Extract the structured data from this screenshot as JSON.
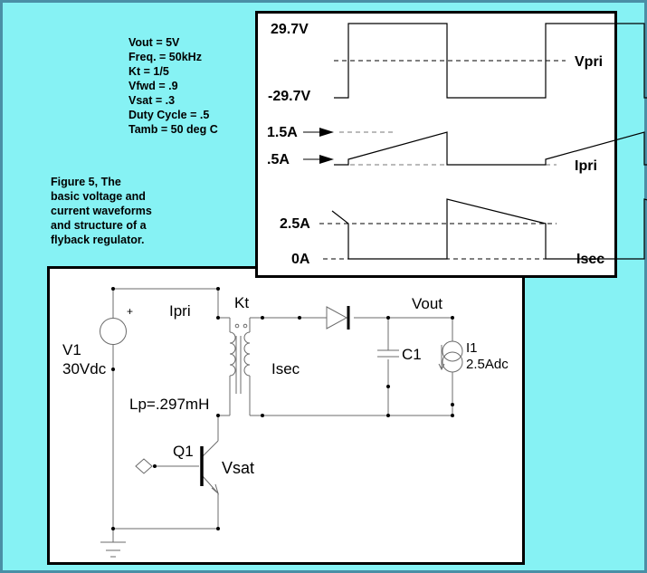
{
  "parameters": [
    {
      "label": "Vout = 5V"
    },
    {
      "label": "Freq. = 50kHz"
    },
    {
      "label": "Kt = 1/5"
    },
    {
      "label": "Vfwd = .9"
    },
    {
      "label": "Vsat = .3"
    },
    {
      "label": "Duty Cycle = .5"
    },
    {
      "label": "Tamb = 50 deg C"
    }
  ],
  "caption": {
    "lines": [
      "Figure 5, The",
      "basic voltage and",
      "current waveforms",
      "and structure of a",
      "flyback regulator."
    ]
  },
  "waveforms": {
    "vpri": {
      "name": "Vpri",
      "high_label": "29.7V",
      "low_label": "-29.7V",
      "high": 29.7,
      "low": -29.7
    },
    "ipri": {
      "name": "Ipri",
      "peak_label": "1.5A",
      "start_label": ".5A",
      "peak": 1.5,
      "start": 0.5
    },
    "isec": {
      "name": "Isec",
      "level_label": "2.5A",
      "zero_label": "0A",
      "level": 2.5,
      "zero": 0
    },
    "duty_cycle": 0.5,
    "cycles_shown": 2
  },
  "schematic": {
    "source": {
      "name": "V1",
      "value": "30Vdc",
      "polarity": "+"
    },
    "transformer": {
      "name": "Kt",
      "primary_inductance": "Lp=.297mH",
      "primary_current": "Ipri",
      "secondary_current": "Isec"
    },
    "output": {
      "node_label": "Vout"
    },
    "capacitor": {
      "name": "C1"
    },
    "load": {
      "name": "I1",
      "value": "2.5Adc"
    },
    "transistor": {
      "name": "Q1",
      "annotation": "Vsat"
    }
  }
}
